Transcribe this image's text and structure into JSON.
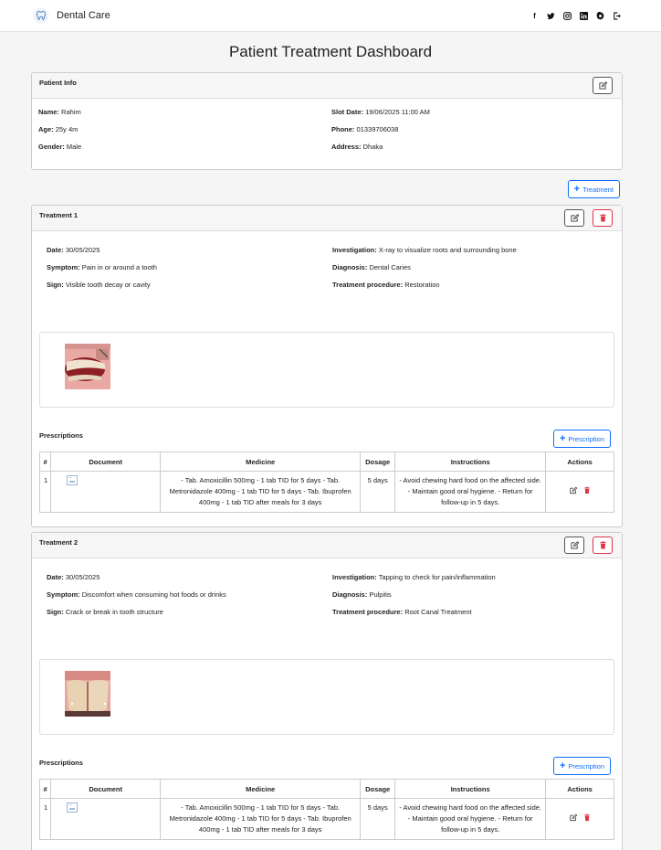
{
  "app": {
    "name": "Dental Care"
  },
  "nav": {
    "icons": [
      "facebook-icon",
      "twitter-icon",
      "instagram-icon",
      "linkedin-icon",
      "gear-icon",
      "logout-icon"
    ]
  },
  "page": {
    "title": "Patient Treatment Dashboard"
  },
  "patient": {
    "header": "Patient Info",
    "name_label": "Name:",
    "name": "Rahim",
    "age_label": "Age:",
    "age": "25y 4m",
    "gender_label": "Gender:",
    "gender": "Male",
    "slot_label": "Slot Date:",
    "slot": "19/06/2025 11:00 AM",
    "phone_label": "Phone:",
    "phone": "01339706038",
    "address_label": "Address:",
    "address": "Dhaka"
  },
  "add_treatment_label": "Treatment",
  "labels": {
    "date": "Date:",
    "symptom": "Symptom:",
    "sign": "Sign:",
    "investigation": "Investigation:",
    "diagnosis": "Diagnosis:",
    "procedure": "Treatment procedure:",
    "prescriptions": "Prescriptions",
    "add_prescription": "Prescription"
  },
  "table_headers": [
    "#",
    "Document",
    "Medicine",
    "Dosage",
    "Instructions",
    "Actions"
  ],
  "treatments": [
    {
      "title": "Treatment 1",
      "date": "30/05/2025",
      "symptom": "Pain in or around a tooth",
      "sign": "Visible tooth decay or cavity",
      "investigation": "X-ray to visualize roots and surrounding bone",
      "diagnosis": "Dental Caries",
      "procedure": "Restoration",
      "prescriptions": [
        {
          "num": "1",
          "medicine": "- Tab. Amoxicillin 500mg - 1 tab TID for 5 days - Tab. Metronidazole 400mg - 1 tab TID for 5 days - Tab. Ibuprofen 400mg - 1 tab TID after meals for 3 days",
          "dosage": "5 days",
          "instructions": "- Avoid chewing hard food on the affected side. - Maintain good oral hygiene. - Return for follow-up in 5 days."
        }
      ]
    },
    {
      "title": "Treatment 2",
      "date": "30/05/2025",
      "symptom": "Discomfort when consuming hot foods or drinks",
      "sign": "Crack or break in tooth structure",
      "investigation": "Tapping to check for pain/inflammation",
      "diagnosis": "Pulpitis",
      "procedure": "Root Canal Treatment",
      "prescriptions": [
        {
          "num": "1",
          "medicine": "- Tab. Amoxicillin 500mg - 1 tab TID for 5 days - Tab. Metronidazole 400mg - 1 tab TID for 5 days - Tab. Ibuprofen 400mg - 1 tab TID after meals for 3 days",
          "dosage": "5 days",
          "instructions": "- Avoid chewing hard food on the affected side. - Maintain good oral hygiene. - Return for follow-up in 5 days."
        }
      ]
    }
  ],
  "colors": {
    "primary": "#0d6efd",
    "danger": "#dc3545"
  }
}
